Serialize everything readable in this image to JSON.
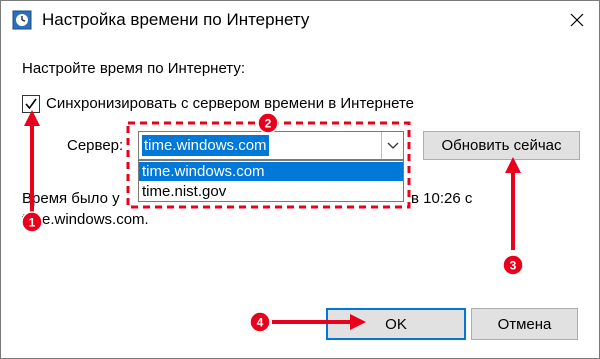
{
  "window": {
    "title": "Настройка времени по Интернету",
    "title_icon": "clock-settings-icon",
    "close_glyph": "✕"
  },
  "main": {
    "heading": "Настройте время по Интернету:",
    "sync_checkbox": {
      "label": "Синхронизировать с сервером времени в Интернете",
      "checked": true
    },
    "server_label": "Сервер:",
    "server_value": "time.windows.com",
    "server_options": [
      "time.windows.com",
      "time.nist.gov"
    ],
    "update_button": "Обновить сейчас",
    "status_line1_start": "Время было у",
    "status_line1_end": "в 10:26 с",
    "status_line2": "time.windows.com."
  },
  "footer": {
    "ok_label": "OK",
    "cancel_label": "Отмена"
  },
  "annotations": {
    "badges": [
      "1",
      "2",
      "3",
      "4"
    ],
    "color": "#e8001c"
  }
}
